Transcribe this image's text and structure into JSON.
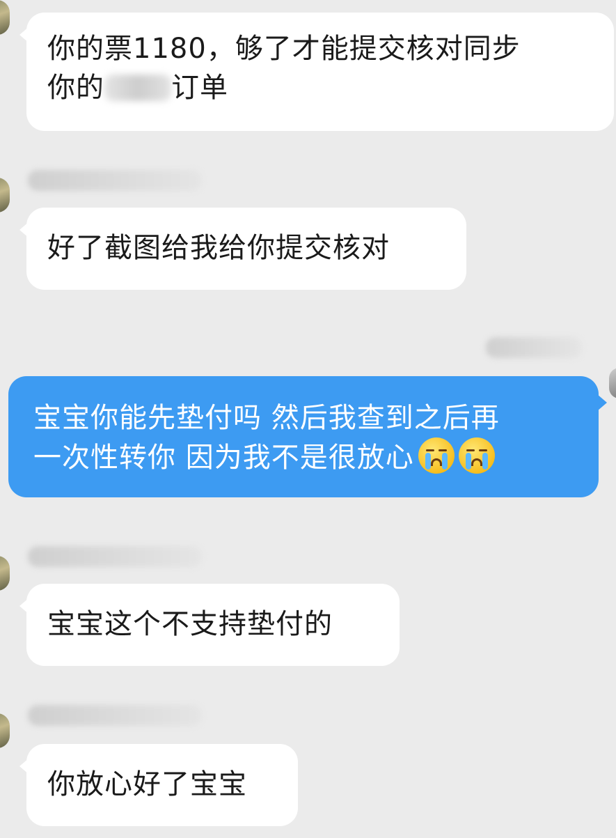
{
  "messages": [
    {
      "sender": "other",
      "parts": [
        "你的票1180，够了才能提交核对同步",
        "你的",
        "订单"
      ]
    },
    {
      "sender": "other",
      "text": "好了截图给我给你提交核对"
    },
    {
      "sender": "me",
      "line1": "宝宝你能先垫付吗 然后我查到之后再",
      "line2": "一次性转你 因为我不是很放心",
      "emojis": [
        "loudly-crying-face-emoji",
        "loudly-crying-face-emoji"
      ]
    },
    {
      "sender": "other",
      "text": "宝宝这个不支持垫付的"
    },
    {
      "sender": "other",
      "text": "你放心好了宝宝"
    }
  ],
  "colors": {
    "background": "#ebebeb",
    "incoming_bubble": "#ffffff",
    "outgoing_bubble": "#3d9bf2",
    "text": "#1a1a1a"
  }
}
